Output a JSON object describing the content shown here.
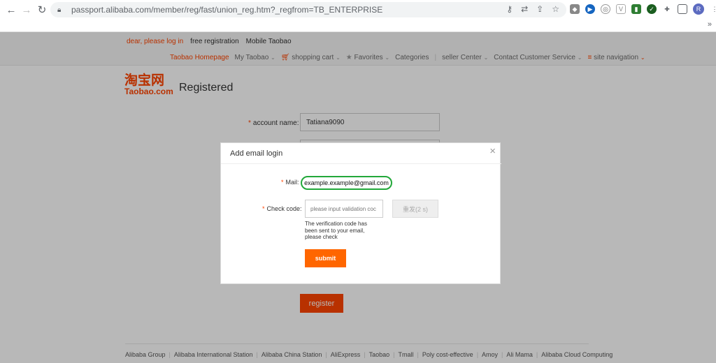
{
  "browser": {
    "url": "passport.alibaba.com/member/reg/fast/union_reg.htm?_regfrom=TB_ENTERPRISE",
    "profile_initial": "R",
    "overflow_label": "»"
  },
  "header": {
    "login_link": "dear, please log in",
    "free_registration": "free registration",
    "mobile": "Mobile Taobao",
    "nav": {
      "home": "Taobao Homepage",
      "my_taobao": "My Taobao",
      "cart": "shopping cart",
      "favorites": "Favorites",
      "categories": "Categories",
      "seller_center": "seller Center",
      "contact": "Contact Customer Service",
      "site_nav": "site navigation"
    }
  },
  "logo": {
    "cn": "淘宝网",
    "en": "Taobao.com"
  },
  "page_title": "Registered",
  "form": {
    "account_label": "account name:",
    "account_value": "Tatiana9090",
    "register_button": "register"
  },
  "modal": {
    "title": "Add email login",
    "close": "×",
    "mail_label": "Mail:",
    "mail_value": "example.example@gmail.com",
    "check_label": "Check code:",
    "code_placeholder": "please input validation coc",
    "resend_button": "重发(2 s)",
    "sent_note": "The verification code has been sent to your email, please check",
    "submit_button": "submit"
  },
  "footer": {
    "links": [
      "Alibaba Group",
      "Alibaba International Station",
      "Alibaba China Station",
      "AliExpress",
      "Taobao",
      "Tmall",
      "Poly cost-effective",
      "Amoy",
      "Ali Mama",
      "Alibaba Cloud Computing"
    ]
  },
  "colors": {
    "brand": "#ff4400",
    "submit": "#ff6600",
    "highlight": "#22a83a"
  }
}
